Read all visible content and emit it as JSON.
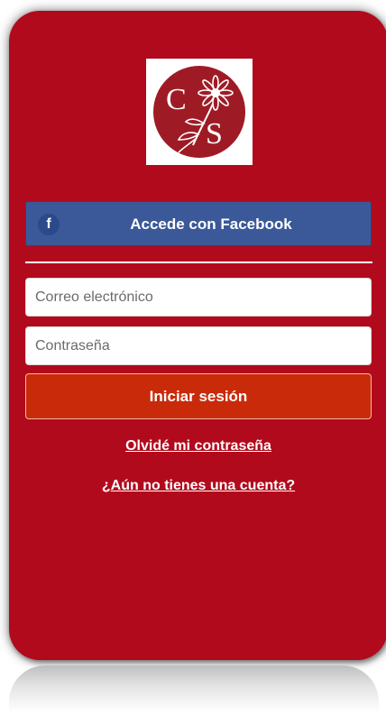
{
  "logo": {
    "letters": [
      "C",
      "S"
    ],
    "colors": {
      "circle": "#9e1b25",
      "background": "#ffffff"
    }
  },
  "facebook": {
    "icon": "facebook-f-icon",
    "label": "Accede con Facebook",
    "color": "#3b5998"
  },
  "form": {
    "email_placeholder": "Correo electrónico",
    "password_placeholder": "Contraseña",
    "submit_label": "Iniciar sesión",
    "submit_color": "#c92a0a"
  },
  "links": {
    "forgot_password": "Olvidé mi contraseña",
    "no_account": "¿Aún no tienes una cuenta?"
  },
  "theme": {
    "card_background": "#b10a1c"
  }
}
